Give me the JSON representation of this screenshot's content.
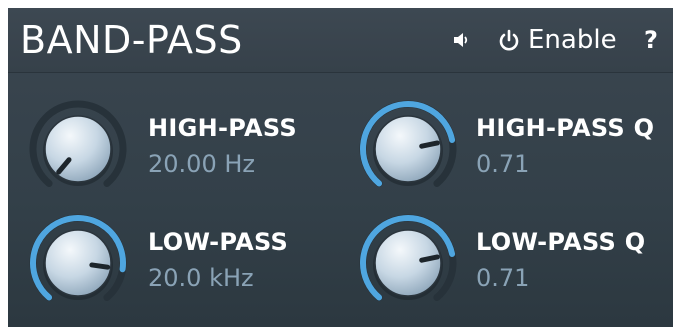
{
  "module": {
    "title": "BAND-PASS",
    "enable_label": "Enable",
    "help_label": "?"
  },
  "params": [
    {
      "name": "HIGH-PASS",
      "value": "20.00 Hz",
      "level": 0.0
    },
    {
      "name": "HIGH-PASS Q",
      "value": "0.71",
      "level": 0.78
    },
    {
      "name": "LOW-PASS",
      "value": "20.0 kHz",
      "level": 0.85
    },
    {
      "name": "LOW-PASS Q",
      "value": "0.71",
      "level": 0.78
    }
  ],
  "colors": {
    "accent": "#4fa6e0",
    "label": "#ffffff",
    "value": "#8aa3b6",
    "panel": "#36414a"
  },
  "icons": {
    "speaker": "speaker-icon",
    "power": "power-icon"
  }
}
